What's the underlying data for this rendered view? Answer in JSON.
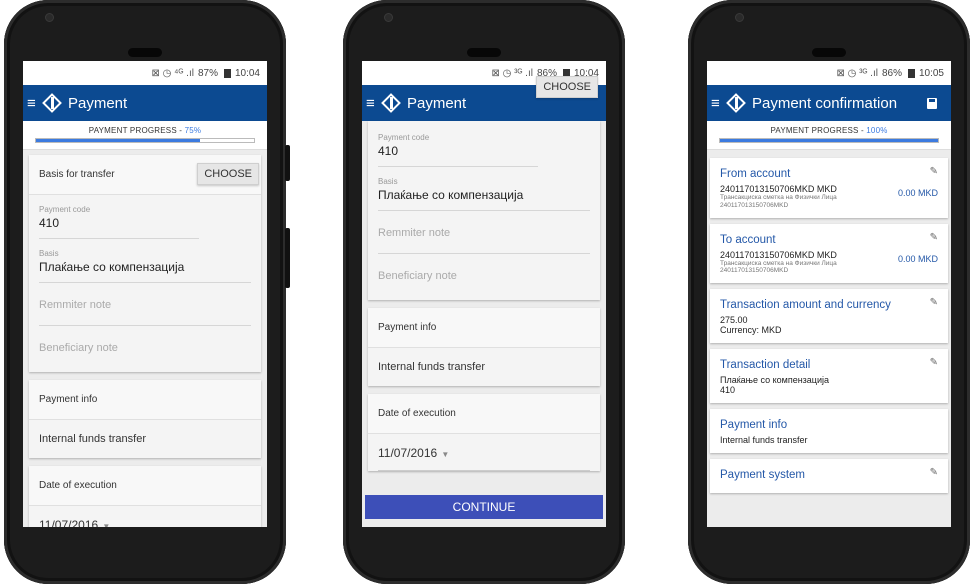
{
  "status": {
    "screen1": {
      "icons": "⊠ ◷ ⁴ᴳ .ıl",
      "battery": "87%",
      "time": "10:04"
    },
    "screen2": {
      "icons": "⊠ ◷ ³ᴳ .ıl",
      "battery": "86%",
      "time": "10:04"
    },
    "screen3": {
      "icons": "⊠ ◷ ³ᴳ .ıl",
      "battery": "86%",
      "time": "10:05"
    }
  },
  "app": {
    "menu_icon": "≡",
    "title_payment": "Payment",
    "title_confirmation": "Payment confirmation"
  },
  "progress": {
    "label": "PAYMENT PROGRESS - ",
    "step1": {
      "pct_text": "75%",
      "value": 0.75
    },
    "step2": {
      "pct_text": "100%",
      "value": 1.0
    }
  },
  "form": {
    "basis_header": "Basis for transfer",
    "payment_code_label": "Payment code",
    "payment_code_value": "410",
    "choose_label": "CHOOSE",
    "basis_label": "Basis",
    "basis_value": "Плаќање со компензација",
    "remitter_placeholder": "Remmiter note",
    "beneficiary_placeholder": "Beneficiary note",
    "payment_info_header": "Payment info",
    "payment_info_value": "Internal funds transfer",
    "date_header": "Date of execution",
    "date_value": "11/07/2016",
    "continue_label": "CONTINUE"
  },
  "confirmation": {
    "from": {
      "title": "From account",
      "account": "240117013150706MKD  MKD",
      "amount": "0.00 MKD",
      "desc": "Трансакциска сметка на Физички Лица",
      "desc2": "240117013150706MKD"
    },
    "to": {
      "title": "To account",
      "account": "240117013150706MKD  MKD",
      "amount": "0.00 MKD",
      "desc": "Трансакциска сметка на Физички Лица",
      "desc2": "240117013150706MKD"
    },
    "amount": {
      "title": "Transaction amount and currency",
      "value": "275.00",
      "currency": "Currency: MKD"
    },
    "detail": {
      "title": "Transaction detail",
      "basis": "Плаќање со компензација",
      "code": "410"
    },
    "info": {
      "title": "Payment info",
      "value": "Internal funds transfer"
    },
    "system": {
      "title": "Payment system"
    }
  },
  "colors": {
    "appbar": "#0c4a91",
    "accent": "#3c7be0",
    "button": "#3d4fb8",
    "link": "#2458a8"
  }
}
